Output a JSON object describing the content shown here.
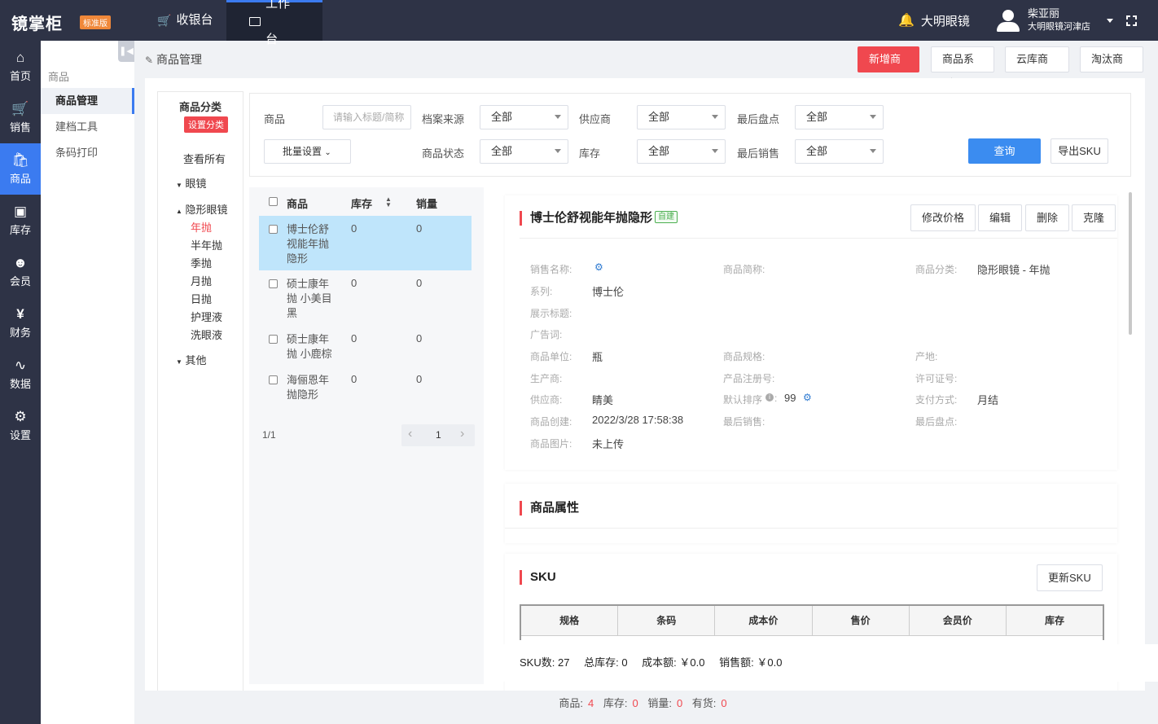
{
  "app": {
    "logo": "镜掌柜",
    "edition": "标准版"
  },
  "topnav": {
    "tabs": [
      {
        "label": "收银台"
      },
      {
        "label": "工作台"
      }
    ]
  },
  "user": {
    "store_short": "大明眼镜",
    "name": "柴亚丽",
    "store_full": "大明眼镜河津店"
  },
  "sidebar": {
    "items": [
      {
        "label": "首页",
        "icon": "home-icon"
      },
      {
        "label": "销售",
        "icon": "cart-icon"
      },
      {
        "label": "商品",
        "icon": "bag-icon"
      },
      {
        "label": "库存",
        "icon": "box-icon"
      },
      {
        "label": "会员",
        "icon": "users-icon"
      },
      {
        "label": "财务",
        "icon": "yen-icon"
      },
      {
        "label": "数据",
        "icon": "pulse-icon"
      },
      {
        "label": "设置",
        "icon": "gear-icon"
      }
    ]
  },
  "subnav": {
    "title": "商品",
    "items": [
      {
        "label": "商品管理"
      },
      {
        "label": "建档工具"
      },
      {
        "label": "条码打印"
      }
    ]
  },
  "page": {
    "breadcrumb": "商品管理"
  },
  "header_buttons": {
    "add": "新增商品",
    "series": "商品系列",
    "cloud": "云库商品",
    "retire": "淘汰商品"
  },
  "category": {
    "title": "商品分类",
    "set_button": "设置分类",
    "view_all": "查看所有",
    "groups": [
      {
        "label": "眼镜"
      },
      {
        "label": "隐形眼镜",
        "children": [
          "年抛",
          "半年抛",
          "季抛",
          "月抛",
          "日抛",
          "护理液",
          "洗眼液"
        ]
      },
      {
        "label": "其他"
      }
    ]
  },
  "filter": {
    "product_label": "商品",
    "product_placeholder": "请输入标题/简称",
    "source_label": "档案来源",
    "source_value": "全部",
    "supplier_label": "供应商",
    "supplier_value": "全部",
    "last_check_label": "最后盘点",
    "last_check_value": "全部",
    "batch_label": "批量设置",
    "status_label": "商品状态",
    "status_value": "全部",
    "stock_label": "库存",
    "stock_value": "全部",
    "last_sale_label": "最后销售",
    "last_sale_value": "全部",
    "query": "查询",
    "export": "导出SKU"
  },
  "list": {
    "headers": {
      "name": "商品",
      "stock": "库存",
      "sales": "销量"
    },
    "rows": [
      {
        "name": "博士伦舒视能年抛隐形",
        "stock": "0",
        "sales": "0"
      },
      {
        "name": "硕士康年抛 小美目黑",
        "stock": "0",
        "sales": "0"
      },
      {
        "name": "硕士康年抛 小鹿棕",
        "stock": "0",
        "sales": "0"
      },
      {
        "name": "海俪恩年抛隐形",
        "stock": "0",
        "sales": "0"
      }
    ],
    "page_info": "1/1",
    "page_num": "1"
  },
  "detail": {
    "title": "博士伦舒视能年抛隐形",
    "tag": "自建",
    "buttons": {
      "price": "修改价格",
      "edit": "编辑",
      "delete": "删除",
      "clone": "克隆"
    },
    "fields": {
      "sale_name_label": "销售名称:",
      "short_name_label": "商品简称:",
      "category_label": "商品分类:",
      "category_value": "隐形眼镜 - 年抛",
      "series_label": "系列:",
      "series_value": "博士伦",
      "display_title_label": "展示标题:",
      "ad_label": "广告词:",
      "unit_label": "商品单位:",
      "unit_value": "瓶",
      "spec_label": "商品规格:",
      "origin_label": "产地:",
      "maker_label": "生产商:",
      "reg_label": "产品注册号:",
      "license_label": "许可证号:",
      "supplier_label": "供应商:",
      "supplier_value": "睛美",
      "sort_label": "默认排序",
      "sort_value": "99",
      "pay_label": "支付方式:",
      "pay_value": "月结",
      "created_label": "商品创建:",
      "created_value": "2022/3/28 17:58:38",
      "last_sale_label": "最后销售:",
      "last_check_label": "最后盘点:",
      "image_label": "商品图片:",
      "image_value": "未上传"
    }
  },
  "attributes": {
    "title": "商品属性"
  },
  "sku": {
    "title": "SKU",
    "update": "更新SKU",
    "columns": [
      "规格",
      "条码",
      "成本价",
      "售价",
      "会员价",
      "库存"
    ]
  },
  "summary": {
    "sku_count_label": "SKU数:",
    "sku_count": "27",
    "total_stock_label": "总库存:",
    "total_stock": "0",
    "cost_label": "成本额:",
    "cost": "￥0.0",
    "sales_amt_label": "销售额:",
    "sales_amt": "￥0.0"
  },
  "footer": {
    "product_label": "商品:",
    "product": "4",
    "stock_label": "库存:",
    "stock": "0",
    "sales_label": "销量:",
    "sales": "0",
    "instock_label": "有货:",
    "instock": "0"
  }
}
